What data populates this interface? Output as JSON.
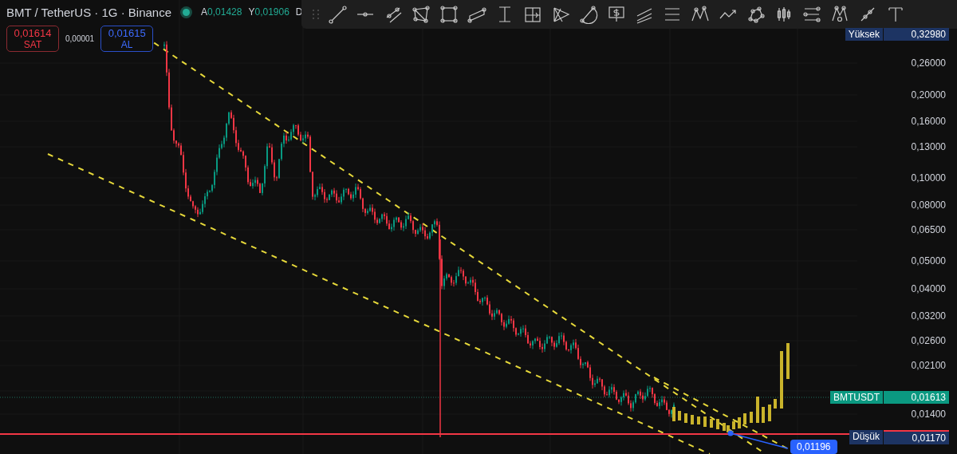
{
  "header": {
    "title": "BMT / TetherUS · 1G · Binance",
    "ohlc": [
      {
        "label": "A",
        "value": "0,01428"
      },
      {
        "label": "Y",
        "value": "0,01906"
      }
    ],
    "cut_label": "D"
  },
  "trade_buttons": [
    {
      "kind": "sell",
      "price": "0,01614",
      "action": "SAT"
    },
    {
      "kind": "buy",
      "price": "0,01615",
      "action": "AL"
    }
  ],
  "spread": "0,00001",
  "price_axis": {
    "ticks": [
      "0,26000",
      "0,20000",
      "0,16000",
      "0,13000",
      "0,10000",
      "0,08000",
      "0,06500",
      "0,05000",
      "0,04000",
      "0,03200",
      "0,02600",
      "0,02100",
      "0,01400"
    ],
    "markers": [
      {
        "kind": "high",
        "label": "Yüksek",
        "value": "0,32980"
      },
      {
        "kind": "last",
        "label": "BMTUSDT",
        "value": "0,01613"
      },
      {
        "kind": "low",
        "label": "Düşük",
        "value": "0,01170"
      }
    ]
  },
  "price_callout": "0,01196"
}
